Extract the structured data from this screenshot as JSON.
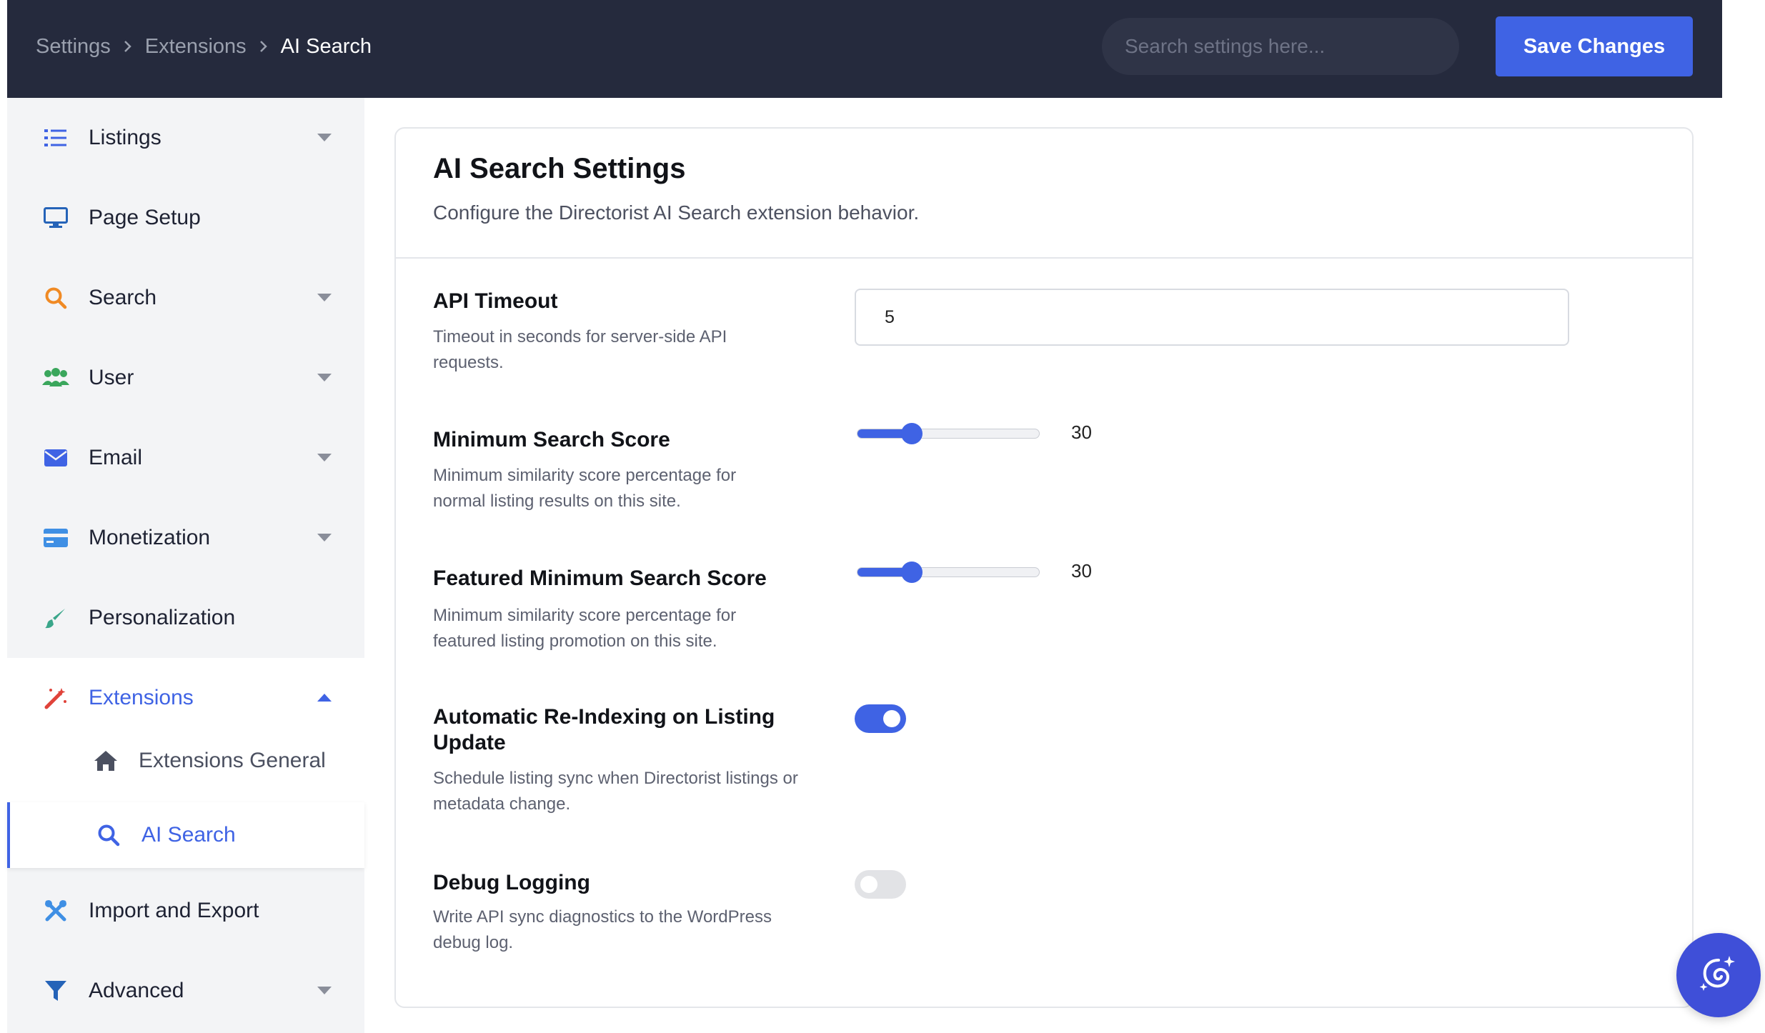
{
  "header": {
    "breadcrumb": [
      "Settings",
      "Extensions",
      "AI Search"
    ],
    "search_placeholder": "Search settings here...",
    "save_label": "Save Changes"
  },
  "sidebar": {
    "items": [
      {
        "label": "Listings",
        "icon": "list-icon",
        "has_caret": true
      },
      {
        "label": "Page Setup",
        "icon": "monitor-icon",
        "has_caret": false
      },
      {
        "label": "Search",
        "icon": "search-icon",
        "has_caret": true
      },
      {
        "label": "User",
        "icon": "users-icon",
        "has_caret": true
      },
      {
        "label": "Email",
        "icon": "envelope-icon",
        "has_caret": true
      },
      {
        "label": "Monetization",
        "icon": "credit-card-icon",
        "has_caret": true
      },
      {
        "label": "Personalization",
        "icon": "brush-icon",
        "has_caret": false
      },
      {
        "label": "Extensions",
        "icon": "magic-wand-icon",
        "has_caret": true,
        "expanded": true
      },
      {
        "label": "Import and Export",
        "icon": "tools-icon",
        "has_caret": false
      },
      {
        "label": "Advanced",
        "icon": "filter-icon",
        "has_caret": true
      }
    ],
    "sub_items": [
      {
        "label": "Extensions General",
        "icon": "home-icon"
      },
      {
        "label": "AI Search",
        "icon": "search-icon",
        "current": true
      }
    ]
  },
  "main": {
    "title": "AI Search Settings",
    "subtitle": "Configure the Directorist AI Search extension behavior.",
    "api_timeout": {
      "title": "API Timeout",
      "desc": "Timeout in seconds for server-side API requests.",
      "value": "5"
    },
    "min_score": {
      "title": "Minimum Search Score",
      "desc": "Minimum similarity score percentage for normal listing results on this site.",
      "value": 30,
      "value_label": "30"
    },
    "featured_min_score": {
      "title": "Featured Minimum Search Score",
      "desc": "Minimum similarity score percentage for featured listing promotion on this site.",
      "value": 30,
      "value_label": "30"
    },
    "auto_reindex": {
      "title": "Automatic Re-Indexing on Listing Update",
      "desc": "Schedule listing sync when Directorist listings or metadata change.",
      "enabled": true
    },
    "debug_logging": {
      "title": "Debug Logging",
      "desc": "Write API sync diagnostics to the WordPress debug log.",
      "enabled": false
    }
  },
  "colors": {
    "accent": "#3f63e4",
    "topbar": "#252a3d",
    "sidebar": "#f3f4f6"
  }
}
